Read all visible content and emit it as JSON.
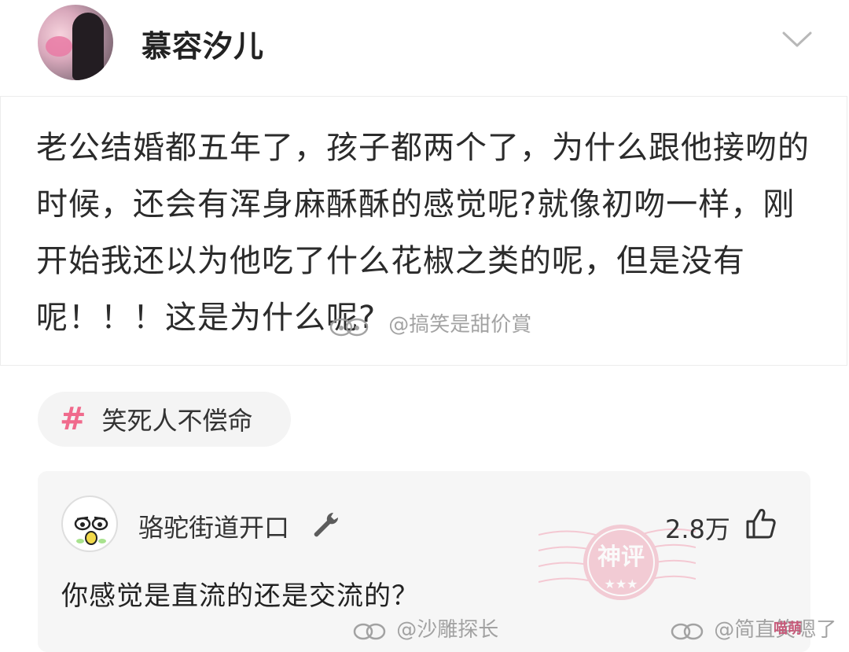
{
  "post": {
    "author": "慕容汐儿",
    "content": "老公结婚都五年了，孩子都两个了，为什么跟他接吻的时候，还会有浑身麻酥酥的感觉呢?就像初吻一样，刚开始我还以为他吃了什么花椒之类的呢，但是没有呢！！！这是为什么呢?"
  },
  "tag": {
    "label": "笑死人不偿命"
  },
  "comment": {
    "author": "骆驼街道开口",
    "likes": "2.8万",
    "text": "你感觉是直流的还是交流的？",
    "stamp_text": "神评"
  },
  "watermarks": {
    "post": "@搞笑是甜价賞",
    "bottom_left": "@沙雕探长",
    "bottom_right": "@简直笑嗯了",
    "corner": "喵萌"
  },
  "icons": {
    "chevron": "chevron-down-icon",
    "hash": "hash-icon",
    "wrench": "wrench-icon",
    "thumb": "thumbs-up-icon",
    "weibo": "weibo-logo-icon"
  },
  "colors": {
    "accent_pink": "#f06a8c",
    "card_bg": "#f6f6f6",
    "text": "#222222"
  }
}
